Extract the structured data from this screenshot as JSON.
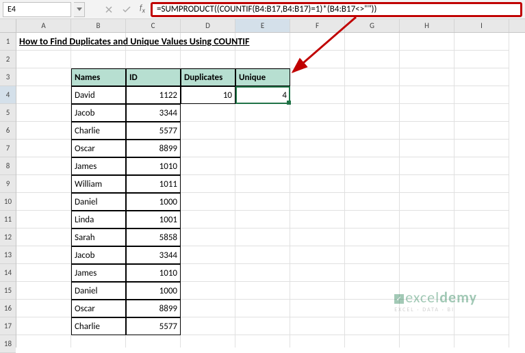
{
  "nameBox": "E4",
  "formula": "=SUMPRODUCT((COUNTIF(B4:B17,B4:B17)=1)*(B4:B17<>\"\"))",
  "columns": [
    "A",
    "B",
    "C",
    "D",
    "E",
    "F",
    "G",
    "H",
    "I"
  ],
  "rowCount": 18,
  "activeRow": 4,
  "activeCol": "E",
  "title": "How to Find Duplicates and Unique Values Using COUNTIF",
  "headers": {
    "names": "Names",
    "id": "ID",
    "duplicates": "Duplicates",
    "unique": "Unique"
  },
  "duplicatesValue": "10",
  "uniqueValue": "4",
  "table": [
    {
      "name": "David",
      "id": "1122"
    },
    {
      "name": "Jacob",
      "id": "3344"
    },
    {
      "name": "Charlie",
      "id": "5577"
    },
    {
      "name": "Oscar",
      "id": "8899"
    },
    {
      "name": "James",
      "id": "1010"
    },
    {
      "name": "William",
      "id": "1011"
    },
    {
      "name": "Daniel",
      "id": "1000"
    },
    {
      "name": "Linda",
      "id": "1001"
    },
    {
      "name": "Sarah",
      "id": "5858"
    },
    {
      "name": "Jacob",
      "id": "3344"
    },
    {
      "name": "James",
      "id": "1010"
    },
    {
      "name": "Daniel",
      "id": "1000"
    },
    {
      "name": "Oscar",
      "id": "8899"
    },
    {
      "name": "Charlie",
      "id": "5577"
    }
  ],
  "watermark": {
    "brand_light": "excel",
    "brand_bold": "demy",
    "sub": "EXCEL · DATA · BI"
  }
}
